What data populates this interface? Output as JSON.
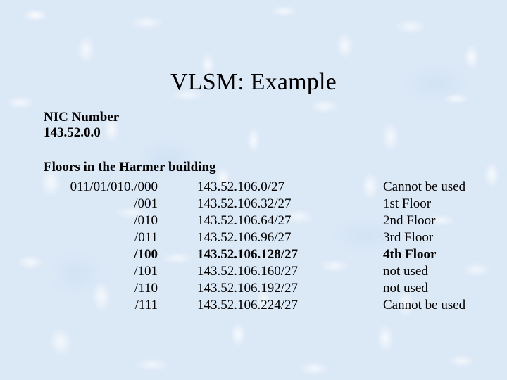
{
  "slide": {
    "title": "VLSM: Example",
    "background_color": "#dce9f7",
    "text_color": "#000000"
  },
  "nic": {
    "label": "NIC Number",
    "address": "143.52.0.0"
  },
  "floors": {
    "heading": "Floors in the Harmer building"
  },
  "subnet_table": {
    "rows": [
      {
        "binary": "011/01/010./000",
        "subnet": "143.52.106.0/27",
        "usage": "Cannot be used",
        "bold": false
      },
      {
        "binary": "/001",
        "subnet": "143.52.106.32/27",
        "usage": "1st Floor",
        "bold": false
      },
      {
        "binary": "/010",
        "subnet": "143.52.106.64/27",
        "usage": "2nd Floor",
        "bold": false
      },
      {
        "binary": "/011",
        "subnet": "143.52.106.96/27",
        "usage": "3rd Floor",
        "bold": false
      },
      {
        "binary": "/100",
        "subnet": "143.52.106.128/27",
        "usage": "4th Floor",
        "bold": true
      },
      {
        "binary": "/101",
        "subnet": "143.52.106.160/27",
        "usage": "not used",
        "bold": false
      },
      {
        "binary": "/110",
        "subnet": "143.52.106.192/27",
        "usage": "not used",
        "bold": false
      },
      {
        "binary": "/111",
        "subnet": "143.52.106.224/27",
        "usage": "Cannot be used",
        "bold": false
      }
    ]
  }
}
